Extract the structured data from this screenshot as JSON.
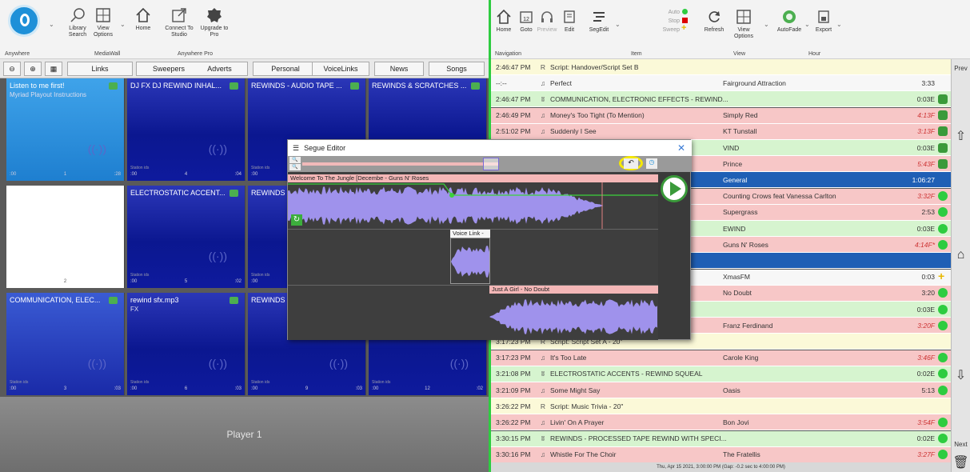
{
  "ribbon": {
    "left": {
      "library_search": "Library Search",
      "view_options": "View Options",
      "home": "Home",
      "connect_studio": "Connect To Studio",
      "upgrade": "Upgrade to Pro",
      "groups": {
        "anywhere": "Anywhere",
        "mediawall": "MediaWall",
        "anywhere_pro": "Anywhere Pro"
      }
    },
    "right": {
      "home": "Home",
      "goto": "Goto",
      "preview": "Preview",
      "edit": "Edit",
      "segedit": "SegEdit",
      "auto": "Auto",
      "stop": "Stop",
      "sweep": "Sweep",
      "refresh": "Refresh",
      "view_options": "View Options",
      "autofade": "AutoFade",
      "export": "Export",
      "calendar_day": "12",
      "groups": {
        "navigation": "Navigation",
        "item": "Item",
        "view": "View",
        "hour": "Hour"
      }
    }
  },
  "cart": {
    "tabs": [
      "Links",
      "Sweepers",
      "Adverts",
      "Personal",
      "VoiceLinks",
      "News",
      "Songs"
    ],
    "tiles": [
      {
        "title": "Listen to me first!",
        "sub": "Myriad Playout Instructions",
        "ft": [
          ":00",
          "1",
          ":28"
        ],
        "label": ""
      },
      {
        "title": "DJ FX DJ REWIND INHAL...",
        "sub": "",
        "ft": [
          ":00",
          "4",
          ":04"
        ],
        "label": "Station ids"
      },
      {
        "title": "REWINDS - AUDIO TAPE ...",
        "sub": "",
        "ft": [
          ":00",
          "",
          ""
        ],
        "label": "Station ids"
      },
      {
        "title": "REWINDS & SCRATCHES ...",
        "sub": "",
        "ft": [
          "",
          "",
          ""
        ],
        "label": ""
      },
      {
        "title": "",
        "sub": "",
        "ft": [
          "",
          "2",
          ""
        ],
        "label": ""
      },
      {
        "title": "ELECTROSTATIC ACCENT...",
        "sub": "",
        "ft": [
          ":00",
          "5",
          ":02"
        ],
        "label": "Station ids"
      },
      {
        "title": "REWINDS",
        "sub": "",
        "ft": [
          ":00",
          "",
          ""
        ],
        "label": "Station ids"
      },
      {
        "title": "",
        "sub": "",
        "ft": [
          "",
          "",
          ""
        ],
        "label": ""
      },
      {
        "title": "COMMUNICATION, ELEC...",
        "sub": "",
        "ft": [
          ":00",
          "3",
          ":03"
        ],
        "label": "Station ids"
      },
      {
        "title": "rewind sfx.mp3",
        "sub": "FX",
        "ft": [
          ":00",
          "6",
          ":03"
        ],
        "label": "Station ids"
      },
      {
        "title": "REWINDS",
        "sub": "",
        "ft": [
          ":00",
          "9",
          ":03"
        ],
        "label": "Station ids"
      },
      {
        "title": "",
        "sub": "",
        "ft": [
          ":00",
          "12",
          ":02"
        ],
        "label": "Station ids"
      }
    ],
    "player": "Player 1"
  },
  "log": {
    "rows": [
      {
        "time": "2:46:47 PM",
        "icon": "R",
        "title": "Script: Handover/Script Set B",
        "artist": "",
        "dur": "",
        "cls": "y",
        "st": ""
      },
      {
        "time": "--:--",
        "icon": "♫",
        "title": "Perfect",
        "artist": "Fairground Attraction",
        "dur": "3:33",
        "cls": "w",
        "st": ""
      },
      {
        "time": "2:46:47 PM",
        "icon": "ʬ",
        "title": "COMMUNICATION, ELECTRONIC EFFECTS - REWIND...",
        "artist": "",
        "dur": "0:03E",
        "cls": "g",
        "st": "chk"
      },
      {
        "time": "2:46:49 PM",
        "icon": "♫",
        "title": "Money's Too Tight (To Mention)",
        "artist": "Simply Red",
        "dur": "4:13F",
        "cls": "r",
        "st": "chk"
      },
      {
        "time": "2:51:02 PM",
        "icon": "♫",
        "title": "Suddenly I See",
        "artist": "KT Tunstall",
        "dur": "3:13F",
        "cls": "r",
        "st": "chk"
      },
      {
        "time": "",
        "icon": "",
        "title": "",
        "artist": "VIND",
        "dur": "0:03E",
        "cls": "g",
        "st": "chk"
      },
      {
        "time": "",
        "icon": "",
        "title": "",
        "artist": "Prince",
        "dur": "5:43F",
        "cls": "r",
        "st": "chk"
      },
      {
        "time": "",
        "icon": "",
        "title": "",
        "artist": "General",
        "dur": "1:06:27",
        "cls": "b",
        "st": ""
      },
      {
        "time": "",
        "icon": "",
        "title": "",
        "artist": "Counting Crows feat Vanessa Carlton",
        "dur": "3:32F",
        "cls": "r",
        "st": "dot"
      },
      {
        "time": "",
        "icon": "",
        "title": "",
        "artist": "Supergrass",
        "dur": "2:53",
        "cls": "r",
        "st": "dot"
      },
      {
        "time": "",
        "icon": "",
        "title": "",
        "artist": "EWIND",
        "dur": "0:03E",
        "cls": "g",
        "st": "dot"
      },
      {
        "time": "",
        "icon": "",
        "title": "",
        "artist": "Guns N' Roses",
        "dur": "4:14F*",
        "cls": "r",
        "st": "dot"
      },
      {
        "time": "",
        "icon": "",
        "title": "",
        "artist": "",
        "dur": "",
        "cls": "b",
        "st": ""
      },
      {
        "time": "",
        "icon": "",
        "title": "",
        "artist": "XmasFM",
        "dur": "0:03",
        "cls": "w",
        "st": "plus"
      },
      {
        "time": "",
        "icon": "",
        "title": "",
        "artist": "No Doubt",
        "dur": "3:20",
        "cls": "r",
        "st": "dot"
      },
      {
        "time": "",
        "icon": "",
        "title": "",
        "artist": "",
        "dur": "0:03E",
        "cls": "g",
        "st": "dot"
      },
      {
        "time": "",
        "icon": "",
        "title": "",
        "artist": "Franz Ferdinand",
        "dur": "3:20F",
        "cls": "r",
        "st": "dot"
      },
      {
        "time": "3:17:23 PM",
        "icon": "R",
        "title": "Script: Script Set A - 20\"",
        "artist": "",
        "dur": "",
        "cls": "y",
        "st": ""
      },
      {
        "time": "3:17:23 PM",
        "icon": "♫",
        "title": "It's Too Late",
        "artist": "Carole King",
        "dur": "3:46F",
        "cls": "r",
        "st": "dot"
      },
      {
        "time": "3:21:08 PM",
        "icon": "ʬ",
        "title": "ELECTROSTATIC ACCENTS - REWIND SQUEAL",
        "artist": "",
        "dur": "0:02E",
        "cls": "g",
        "st": "dot"
      },
      {
        "time": "3:21:09 PM",
        "icon": "♫",
        "title": "Some Might Say",
        "artist": "Oasis",
        "dur": "5:13",
        "cls": "r",
        "st": "dot"
      },
      {
        "time": "3:26:22 PM",
        "icon": "R",
        "title": "Script: Music Trivia - 20\"",
        "artist": "",
        "dur": "",
        "cls": "y",
        "st": ""
      },
      {
        "time": "3:26:22 PM",
        "icon": "♫",
        "title": "Livin' On A Prayer",
        "artist": "Bon Jovi",
        "dur": "3:54F",
        "cls": "r",
        "st": "dot"
      },
      {
        "time": "3:30:15 PM",
        "icon": "ʬ",
        "title": "REWINDS - PROCESSED TAPE REWIND WITH SPECI...",
        "artist": "",
        "dur": "0:02E",
        "cls": "g",
        "st": "dot"
      },
      {
        "time": "3:30:16 PM",
        "icon": "♫",
        "title": "Whistle For The Choir",
        "artist": "The Fratellis",
        "dur": "3:27F",
        "cls": "r",
        "st": "dot"
      }
    ],
    "status": "Thu, Apr 15 2021, 3:00:00 PM (Gap: -0.2 sec to 4:00:00 PM)",
    "prev": "Prev",
    "next": "Next"
  },
  "segue": {
    "title": "Segue Editor",
    "track1": "Welcome To The Jungle [Decembe - Guns N' Roses",
    "voice": "Voice Link -",
    "track3": "Just A Girl - No Doubt"
  },
  "colors": {
    "accent": "#1f5fb5",
    "green": "#2ecc40",
    "highlight": "#f5e800"
  }
}
